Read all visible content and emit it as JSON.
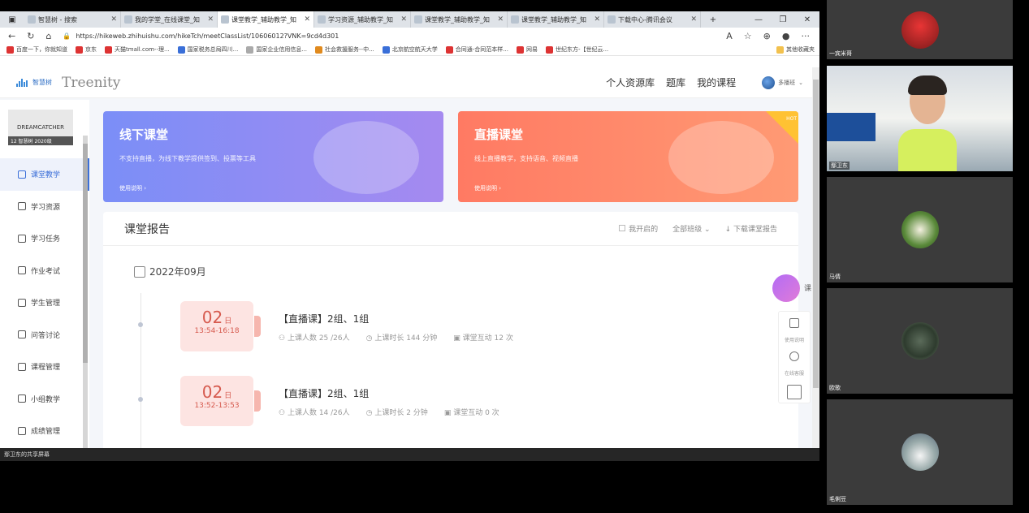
{
  "browser": {
    "tabs": [
      {
        "label": "智慧树 - 搜索",
        "active": false
      },
      {
        "label": "我的学堂_在线课堂_知",
        "active": false
      },
      {
        "label": "课堂教学_辅助教学_知",
        "active": true
      },
      {
        "label": "学习资源_辅助教学_知",
        "active": false
      },
      {
        "label": "课堂教学_辅助教学_知",
        "active": false
      },
      {
        "label": "课堂教学_辅助教学_知",
        "active": false
      },
      {
        "label": "下载中心-腾讯会议",
        "active": false
      }
    ],
    "url": "https://hikeweb.zhihuishu.com/hikeTch/meetClassList/10606012?VNK=9cd4d301",
    "bookmarks": [
      "百度一下，你就知道",
      "京东",
      "天猫tmall.com--理...",
      "国家税务总局四川...",
      "国家企业信用信息...",
      "社会救援服务--中...",
      "北京航空航天大学",
      "合同通-合同范本样...",
      "网易",
      "世纪东方-【世纪云...",
      "其他收藏夹"
    ]
  },
  "header": {
    "logo_text": "智慧树",
    "brand": "Treenity",
    "nav": [
      "个人资源库",
      "题库",
      "我的课程"
    ],
    "user_name": "多播班"
  },
  "sidebar": {
    "logo_caption": "12 智慧树 2020级",
    "items": [
      "课堂教学",
      "学习资源",
      "学习任务",
      "作业考试",
      "学生管理",
      "问答讨论",
      "课程管理",
      "小组教学",
      "成绩管理"
    ],
    "active_index": 0
  },
  "banners": [
    {
      "title": "线下课堂",
      "subtitle": "不支持直播，为线下教学提供签到、投票等工具",
      "link": "使用说明 ›"
    },
    {
      "title": "直播课堂",
      "subtitle": "线上直播教学，支持语音、视频直播",
      "link": "使用说明 ›",
      "badge": "HOT"
    }
  ],
  "report": {
    "title": "课堂报告",
    "filter_mine": "我开启的",
    "filter_class": "全部班级",
    "download": "下载课堂报告",
    "month": "2022年09月",
    "sessions": [
      {
        "day": "02",
        "day_unit": "日",
        "time": "13:54-16:18",
        "title": "【直播课】2组、1组",
        "students": "上课人数 25 /26人",
        "duration": "上课时长 144 分钟",
        "interactions": "课堂互动 12 次"
      },
      {
        "day": "02",
        "day_unit": "日",
        "time": "13:52-13:53",
        "title": "【直播课】2组、1组",
        "students": "上课人数 14 /26人",
        "duration": "上课时长 2 分钟",
        "interactions": "课堂互动 0 次"
      }
    ]
  },
  "floating": {
    "label": "课",
    "tools": [
      "使用说明",
      "在线客服",
      ""
    ]
  },
  "meeting": {
    "share_label": "鄢卫东的共享屏幕",
    "participants": [
      "一宾米哥",
      "鄢卫东",
      "马倩",
      "欧歌",
      "毛俐豆"
    ]
  }
}
